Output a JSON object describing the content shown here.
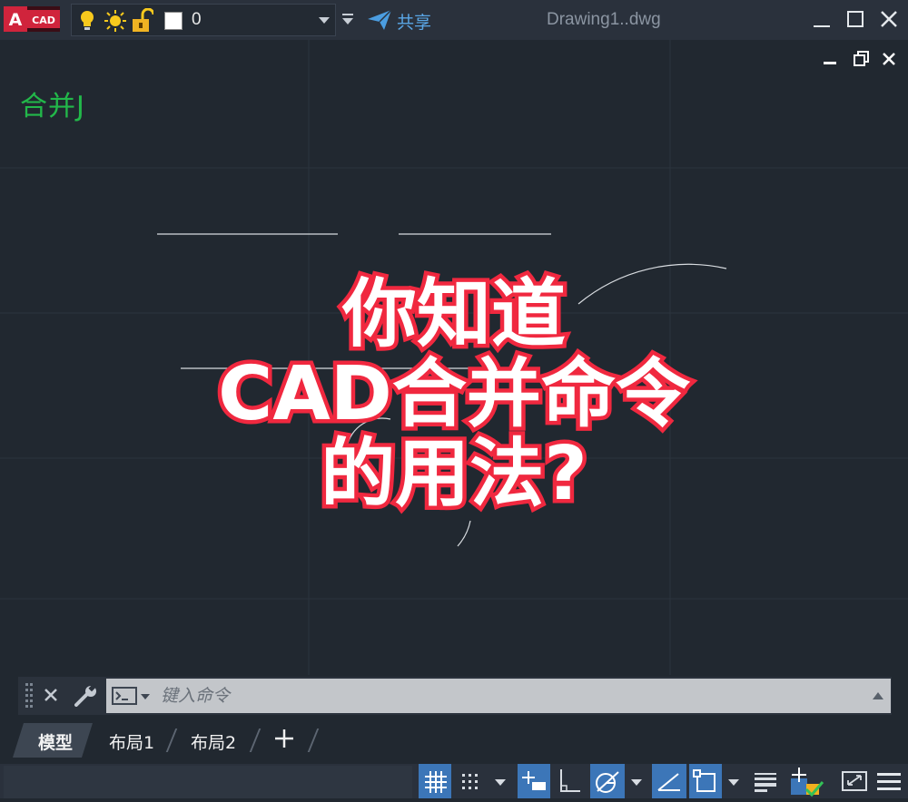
{
  "app": {
    "logo_letter": "A",
    "logo_text": "CAD",
    "document_title": "Drawing1..dwg"
  },
  "quick_access": {
    "current_layer": "0",
    "share_label": "共享"
  },
  "canvas": {
    "drawing_text": "合并J",
    "headline": [
      "你知道",
      "CAD合并命令",
      "的用法?"
    ]
  },
  "command_line": {
    "placeholder": "键入命令"
  },
  "tabs": [
    {
      "label": "模型",
      "active": true
    },
    {
      "label": "布局1",
      "active": false
    },
    {
      "label": "布局2",
      "active": false
    }
  ],
  "colors": {
    "background": "#212830",
    "drawing_text": "#22b84a",
    "headline_outline": "#f0283f",
    "accent_share": "#5aa6e6",
    "toggle_on": "#3c76b8"
  },
  "icons": {
    "titlebar": [
      "lightbulb-icon",
      "sun-icon",
      "unlock-icon",
      "share-icon",
      "minimize-icon",
      "maximize-icon",
      "close-icon"
    ],
    "statusbar": [
      "grid-icon",
      "snap-icon",
      "dynamic-input-icon",
      "ortho-icon",
      "polar-tracking-icon",
      "isodraft-icon",
      "object-snap-icon",
      "lineweight-icon",
      "workspace-icon",
      "fullscreen-icon",
      "customize-icon"
    ]
  }
}
